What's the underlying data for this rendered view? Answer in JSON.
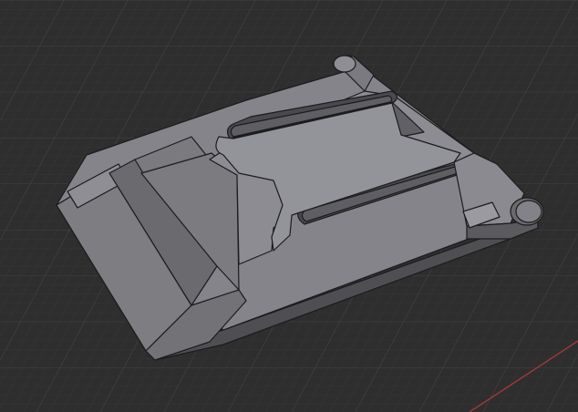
{
  "viewport": {
    "background": "#2e2e2e",
    "grid_minor_color": "#383838",
    "grid_major_color": "#414141",
    "x_axis_color": "#a0383c"
  },
  "model": {
    "body_top": "#8a8a8e",
    "body_side": "#6e6e72",
    "body_dark": "#555559",
    "recess_floor": "#7b7b80",
    "highlight": "#9d9da2",
    "outline": "#1c1c1e"
  }
}
